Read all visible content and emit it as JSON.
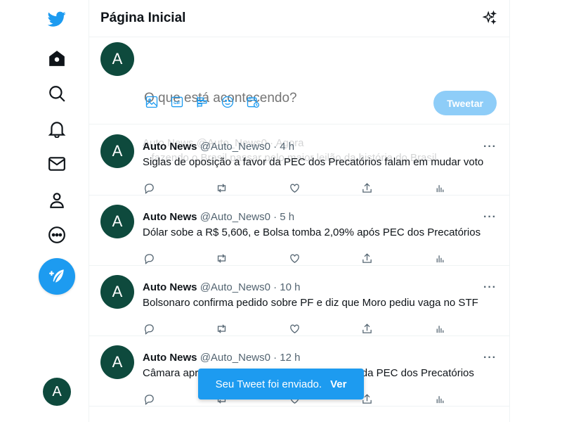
{
  "header": {
    "title": "Página Inicial",
    "sparkle_icon": "sparkle-icon"
  },
  "composer": {
    "avatar_letter": "A",
    "placeholder": "O que está acontecendo?",
    "tools": [
      "image-icon",
      "gif-icon",
      "poll-icon",
      "emoji-icon",
      "schedule-icon"
    ],
    "tweet_button": "Tweetar"
  },
  "nav": {
    "items": [
      "twitter-logo-icon",
      "home-icon",
      "explore-icon",
      "notifications-icon",
      "messages-icon",
      "profile-icon",
      "more-icon"
    ],
    "compose_icon": "compose-tweet-icon",
    "account_letter": "A"
  },
  "ghost_tweet": {
    "header": "Auto News @Auto_News0 · Agora",
    "text": "...fazendo o Brasil passar pelo maior leilão da história do Brasil"
  },
  "tweets": [
    {
      "avatar": "A",
      "name": "Auto News",
      "meta": "@Auto_News0 · 4 h",
      "text": "Siglas de oposição a favor da PEC dos Precatórios falam em mudar voto"
    },
    {
      "avatar": "A",
      "name": "Auto News",
      "meta": "@Auto_News0 · 5 h",
      "text": "Dólar sobe a R$ 5,606, e Bolsa tomba 2,09% após PEC dos Precatórios"
    },
    {
      "avatar": "A",
      "name": "Auto News",
      "meta": "@Auto_News0 · 10 h",
      "text": "Bolsonaro confirma pedido sobre PF e diz que Moro pediu vaga no STF"
    },
    {
      "avatar": "A",
      "name": "Auto News",
      "meta": "@Auto_News0 · 12 h",
      "text": "Câmara aprova, em primeiro turno, texto-base da PEC dos Precatórios"
    }
  ],
  "more_label": "···",
  "toast": {
    "message": "Seu Tweet foi enviado.",
    "link": "Ver"
  },
  "colors": {
    "accent": "#1d9bf0",
    "avatar_bg": "#0e4a3d",
    "disabled_button": "#8ecdf8"
  }
}
